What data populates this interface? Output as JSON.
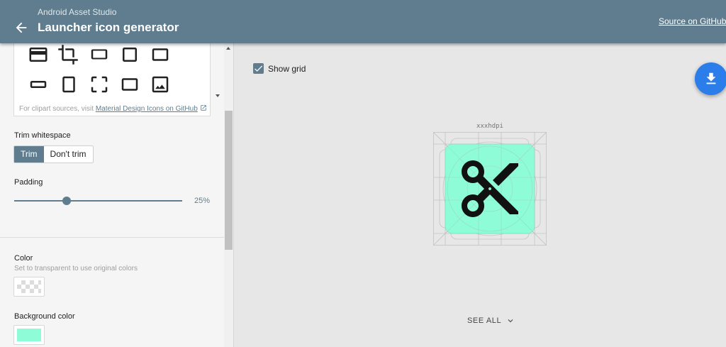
{
  "header": {
    "app_name": "Android Asset Studio",
    "title": "Launcher icon generator",
    "source_link": "Source on GitHub"
  },
  "clipart": {
    "icons_row1": [
      "card-icon",
      "crop-icon",
      "crop-landscape-icon",
      "crop-square-icon",
      "crop-landscape-icon"
    ],
    "icons_row2": [
      "crop-wide-icon",
      "crop-portrait-icon",
      "crop-free-icon",
      "crop-landscape-icon",
      "image-icon"
    ],
    "footer_text": "For clipart sources, visit ",
    "footer_link": "Material Design Icons on GitHub"
  },
  "trim": {
    "label": "Trim whitespace",
    "options": [
      "Trim",
      "Don't trim"
    ],
    "selected": "Trim"
  },
  "padding": {
    "label": "Padding",
    "value_label": "25%",
    "value": 25
  },
  "color": {
    "label": "Color",
    "hint": "Set to transparent to use original colors",
    "value": "transparent"
  },
  "background_color": {
    "label": "Background color",
    "value": "#8ffcd8"
  },
  "preview": {
    "show_grid_label": "Show grid",
    "show_grid_checked": true,
    "density": "xxxhdpi",
    "foreground_icon": "scissors-icon",
    "see_all": "SEE ALL"
  },
  "colors": {
    "header": "#5f7d8e",
    "accent": "#5f7d8e",
    "fab": "#2b7de9",
    "icon_background": "#8ffcd8"
  }
}
